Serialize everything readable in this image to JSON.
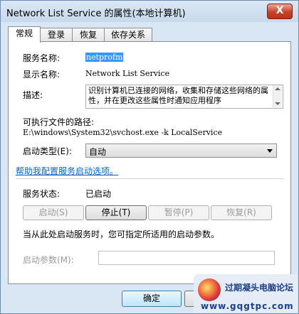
{
  "window": {
    "title": "Network List Service 的属性(本地计算机)",
    "close_label": "X"
  },
  "tabs": [
    {
      "label": "常规"
    },
    {
      "label": "登录"
    },
    {
      "label": "恢复"
    },
    {
      "label": "依存关系"
    }
  ],
  "general": {
    "service_name_label": "服务名称:",
    "service_name_value": "netprofm",
    "display_name_label": "显示名称:",
    "display_name_value": "Network List Service",
    "description_label": "描述:",
    "description_value": "识别计算机已连接的网络，收集和存储这些网络的属性，并在更改这些属性时通知应用程序",
    "exe_path_label": "可执行文件的路径:",
    "exe_path_value": "E:\\windows\\System32\\svchost.exe -k LocalService",
    "startup_type_label": "启动类型(E):",
    "startup_type_value": "自动",
    "help_link": "帮助我配置服务启动选项。",
    "status_label": "服务状态:",
    "status_value": "已启动",
    "start_button": "启动(S)",
    "stop_button": "停止(T)",
    "pause_button": "暂停(P)",
    "resume_button": "恢复(R)",
    "hint_text": "当从此处启动服务时，您可指定所适用的启动参数。",
    "start_params_label": "启动参数(M):",
    "start_params_value": ""
  },
  "footer": {
    "ok_button": "确定"
  },
  "watermark": {
    "text": "过期凝头电脑论坛",
    "url": "www.gqgtpc.com"
  }
}
